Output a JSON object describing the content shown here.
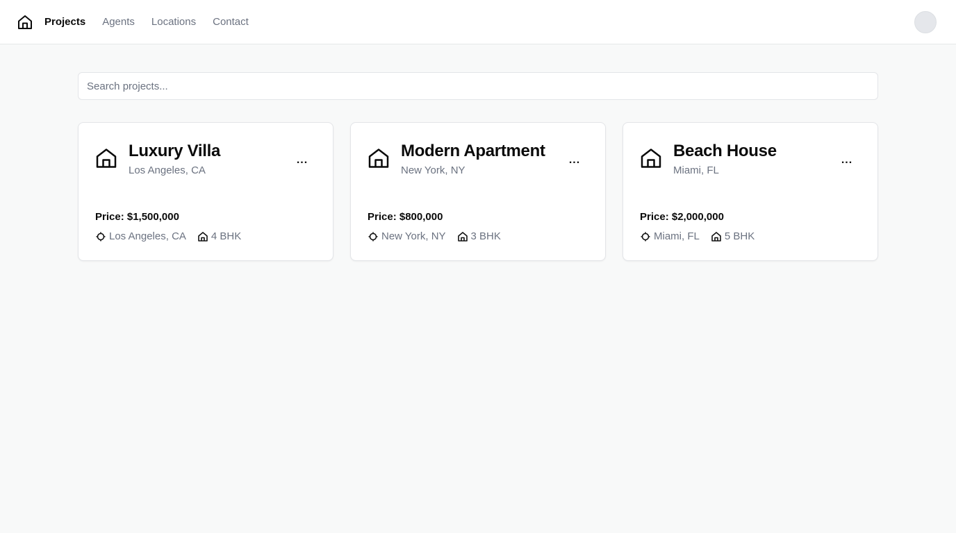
{
  "nav": {
    "logo_icon": "home-icon",
    "items": [
      {
        "label": "Projects",
        "active": true
      },
      {
        "label": "Agents",
        "active": false
      },
      {
        "label": "Locations",
        "active": false
      },
      {
        "label": "Contact",
        "active": false
      }
    ]
  },
  "search": {
    "placeholder": "Search projects...",
    "value": ""
  },
  "projects": [
    {
      "title": "Luxury Villa",
      "subtitle": "Los Angeles, CA",
      "price": "Price: $1,500,000",
      "location": "Los Angeles, CA",
      "bhk": "4 BHK",
      "menu": "..."
    },
    {
      "title": "Modern Apartment",
      "subtitle": "New York, NY",
      "price": "Price: $800,000",
      "location": "New York, NY",
      "bhk": "3 BHK",
      "menu": "..."
    },
    {
      "title": "Beach House",
      "subtitle": "Miami, FL",
      "price": "Price: $2,000,000",
      "location": "Miami, FL",
      "bhk": "5 BHK",
      "menu": "..."
    }
  ],
  "colors": {
    "background": "#f8f9f9",
    "muted_text": "#6b7280",
    "text": "#0a0a0a"
  }
}
